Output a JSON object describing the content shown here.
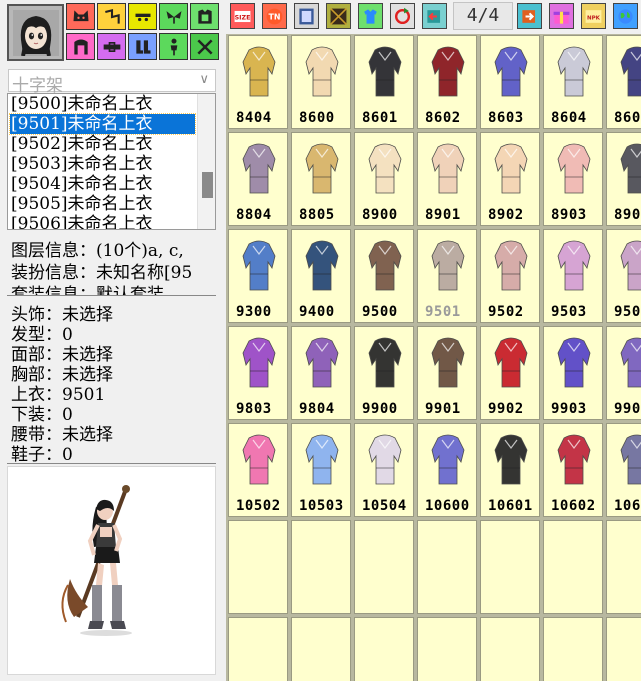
{
  "category_buttons": [
    {
      "icon": "cat-ears-icon",
      "color": "#ff6a5a"
    },
    {
      "icon": "hair-icon",
      "color": "#ffd23c"
    },
    {
      "icon": "eyes-icon",
      "color": "#e8e800"
    },
    {
      "icon": "wings-icon",
      "color": "#5cd95c"
    },
    {
      "icon": "top-clothes-icon",
      "color": "#6ee06e"
    },
    {
      "icon": "arch-icon",
      "color": "#ff69c8"
    },
    {
      "icon": "belt-icon",
      "color": "#d46cf0"
    },
    {
      "icon": "boots-icon",
      "color": "#7aa0ff"
    },
    {
      "icon": "figure-icon",
      "color": "#5cd95c"
    },
    {
      "icon": "crossed-swords-icon",
      "color": "#4bc84b"
    }
  ],
  "dropdown": {
    "value": "十字架"
  },
  "list": {
    "items": [
      "[9500]未命名上衣",
      "[9501]未命名上衣",
      "[9502]未命名上衣",
      "[9503]未命名上衣",
      "[9504]未命名上衣",
      "[9505]未命名上衣",
      "[9506]未命名上衣"
    ],
    "selected_index": 1
  },
  "info": {
    "layer": "图层信息：(10个)a, c,",
    "outfit": "装扮信息：未知名称[95",
    "set": "套装信息：默认套装"
  },
  "status": [
    "头饰：未选择",
    "发型：0",
    "面部：未选择",
    "胸部：未选择",
    "上衣：9501",
    "下装：0",
    "腰带：未选择",
    "鞋子：0"
  ],
  "toolbar": {
    "buttons": [
      {
        "icon": "size-icon",
        "color": "#ff5a5a"
      },
      {
        "icon": "tn-icon",
        "color": "#ff6a4a"
      },
      {
        "icon": "frame-icon",
        "color": "#d8d8d8"
      },
      {
        "icon": "grid-pattern-icon",
        "color": "#b0b040"
      },
      {
        "icon": "shirt-icon",
        "color": "#6ee06e"
      },
      {
        "icon": "refresh-icon",
        "color": "#e0e0e0"
      },
      {
        "icon": "prev-page-icon",
        "color": "#7ad0d0"
      },
      {
        "icon": "next-page-icon",
        "color": "#4ac0d0"
      },
      {
        "icon": "gift-icon",
        "color": "#e070e0"
      },
      {
        "icon": "npk-icon",
        "color": "#f0d060"
      },
      {
        "icon": "globe-icon",
        "color": "#40a0ff"
      }
    ],
    "page_indicator": "4/4"
  },
  "items": [
    [
      {
        "code": "8404",
        "color": "#d8b24a"
      },
      {
        "code": "8600",
        "color": "#f2d8b0"
      },
      {
        "code": "8601",
        "color": "#2a2a30"
      },
      {
        "code": "8602",
        "color": "#8a1a22"
      },
      {
        "code": "8603",
        "color": "#5a5ac8"
      },
      {
        "code": "8604",
        "color": "#c8c8d8"
      },
      {
        "code": "860",
        "color": "#3a3a80"
      }
    ],
    [
      {
        "code": "8804",
        "color": "#9a86a8"
      },
      {
        "code": "8805",
        "color": "#d8b46a"
      },
      {
        "code": "8900",
        "color": "#f4e0c0"
      },
      {
        "code": "8901",
        "color": "#f0d0b8"
      },
      {
        "code": "8902",
        "color": "#f4d4b4"
      },
      {
        "code": "8903",
        "color": "#f0b8b4"
      },
      {
        "code": "890",
        "color": "#50505a"
      }
    ],
    [
      {
        "code": "9300",
        "color": "#4a78c8"
      },
      {
        "code": "9400",
        "color": "#2a4a78"
      },
      {
        "code": "9500",
        "color": "#7a5a4a"
      },
      {
        "code": "9501",
        "color": "#b8a8a0"
      },
      {
        "code": "9502",
        "color": "#d4a8a8"
      },
      {
        "code": "9503",
        "color": "#d4a0d4"
      },
      {
        "code": "950",
        "color": "#c8a0c8"
      }
    ],
    [
      {
        "code": "9803",
        "color": "#9a4ac8"
      },
      {
        "code": "9804",
        "color": "#8a5ab8"
      },
      {
        "code": "9900",
        "color": "#2a2a2a"
      },
      {
        "code": "9901",
        "color": "#6a5040"
      },
      {
        "code": "9902",
        "color": "#c8202a"
      },
      {
        "code": "9903",
        "color": "#5a48c8"
      },
      {
        "code": "990",
        "color": "#7a60c0"
      }
    ],
    [
      {
        "code": "10502",
        "color": "#f070b0"
      },
      {
        "code": "10503",
        "color": "#8ab0f0"
      },
      {
        "code": "10504",
        "color": "#e0d8e8"
      },
      {
        "code": "10600",
        "color": "#6a6ad0"
      },
      {
        "code": "10601",
        "color": "#2a2a2a"
      },
      {
        "code": "10602",
        "color": "#c02a40"
      },
      {
        "code": "106",
        "color": "#7070a0"
      }
    ]
  ],
  "selected_item": "9501"
}
